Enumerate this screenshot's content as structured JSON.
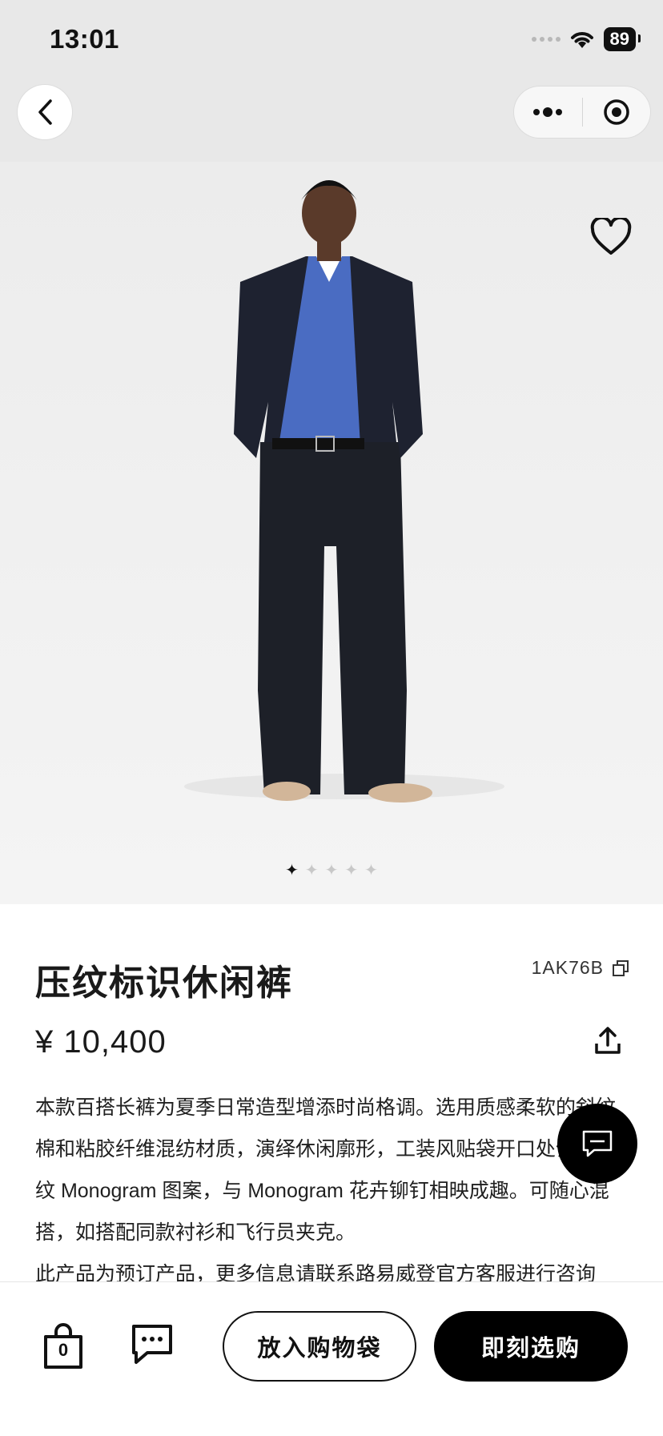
{
  "status_bar": {
    "time": "13:01",
    "battery": "89"
  },
  "product": {
    "title": "压纹标识休闲裤",
    "sku": "1AK76B",
    "price": "¥ 10,400",
    "description_lines": [
      "本款百搭长裤为夏季日常造型增添时尚格调。选用质感柔软的斜纹",
      "棉和粘胶纤维混纺材质，演绎休闲廓形，工装风贴袋开口处饰以压",
      "纹 Monogram 图案，与 Monogram 花卉铆钉相映成趣。可随心混",
      "搭，如搭配同款衬衫和飞行员夹克。",
      "此产品为预订产品，更多信息请联系路易威登官方客服进行咨询"
    ]
  },
  "gallery": {
    "dots": [
      "✦",
      "✦",
      "✦",
      "✦",
      "✦"
    ],
    "active_index": 0
  },
  "bottom_bar": {
    "bag_count": "0",
    "add_to_bag_label": "放入购物袋",
    "buy_now_label": "即刻选购"
  }
}
